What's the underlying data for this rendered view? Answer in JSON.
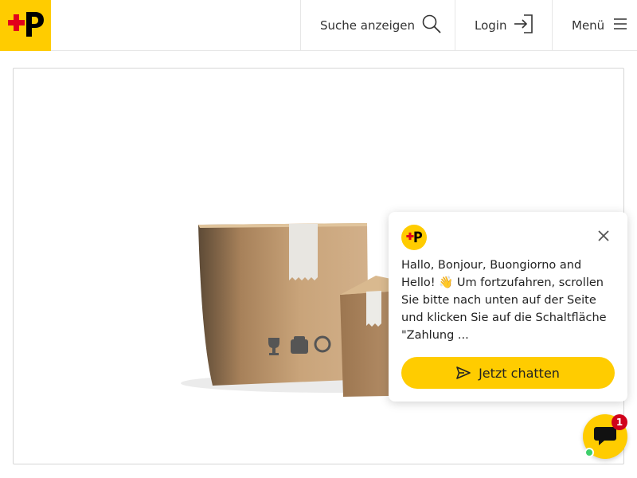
{
  "header": {
    "logo_icon": "swiss-post-logo-icon",
    "search_label": "Suche anzeigen",
    "search_icon": "search-icon",
    "login_label": "Login",
    "login_icon": "login-arrow-icon",
    "menu_label": "Menü",
    "menu_icon": "hamburger-icon"
  },
  "main": {
    "image_subject": "cardboard-boxes-image"
  },
  "chat": {
    "message": "Hallo, Bonjour, Buongiorno and Hello! 👋 Um fortzufahren, scrollen Sie bitte nach unten auf der Seite und klicken Sie auf die Schaltfläche \"Zahlung ...",
    "cta_label": "Jetzt chatten",
    "badge_count": "1"
  },
  "colors": {
    "brand_yellow": "#ffcc00",
    "logo_red": "#e2001a",
    "badge_red": "#d0021b",
    "online_green": "#3ecf6b"
  }
}
